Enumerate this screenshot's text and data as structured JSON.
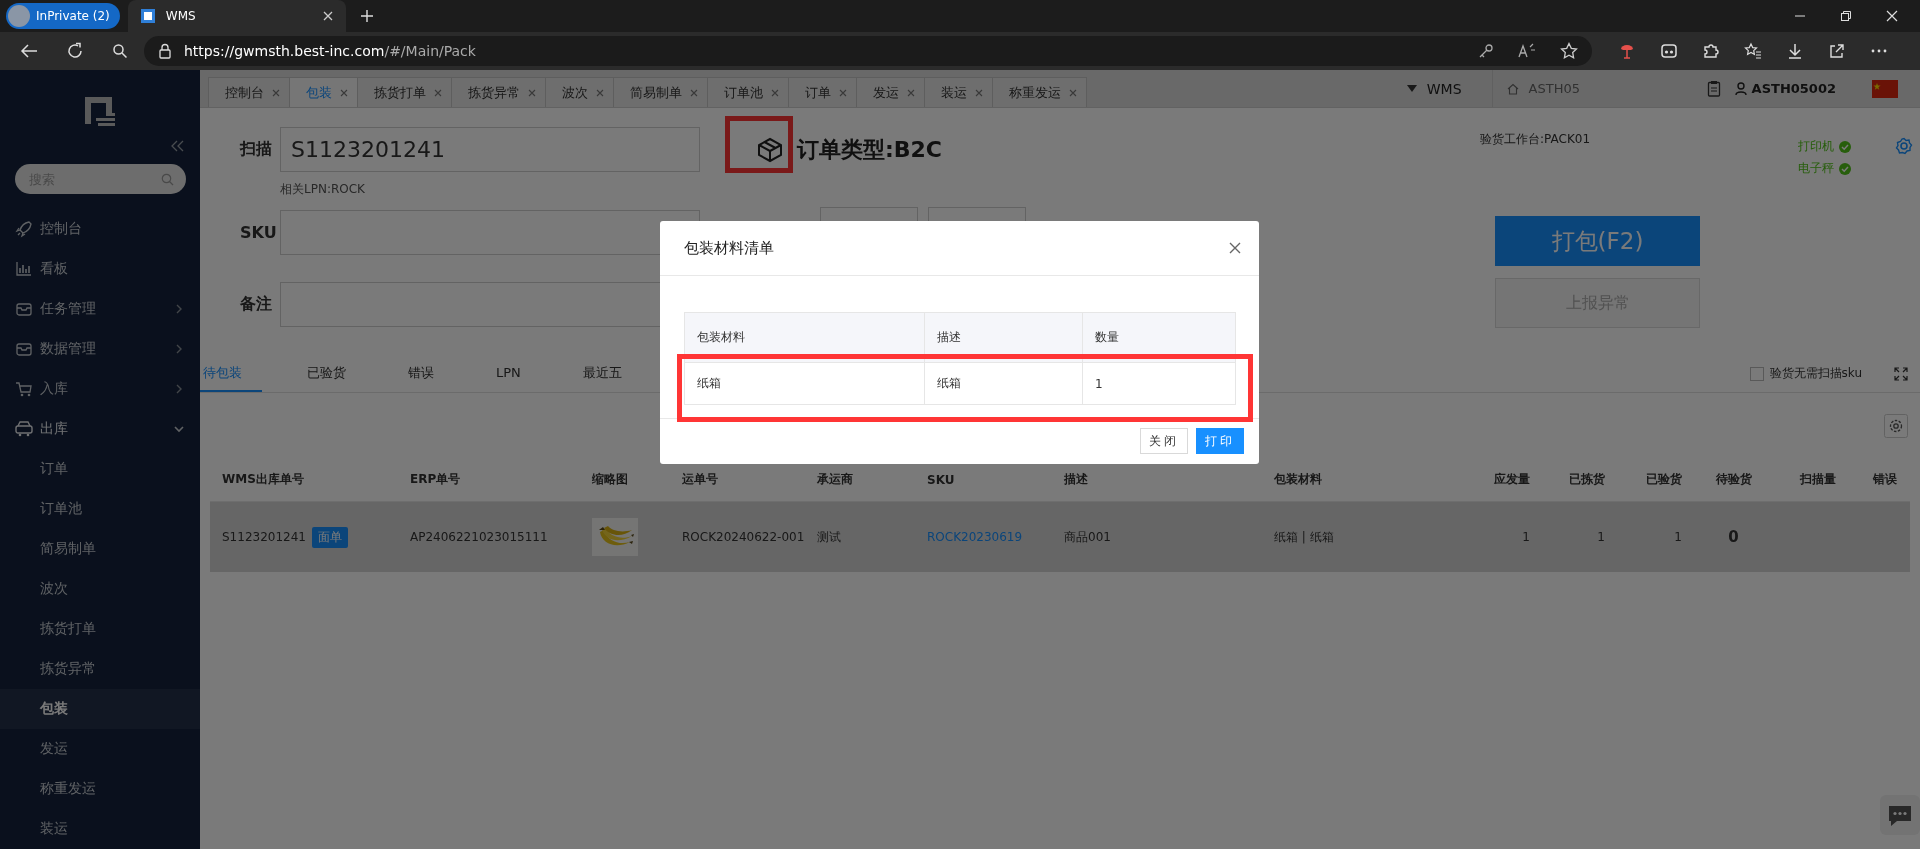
{
  "browser": {
    "profile": "InPrivate (2)",
    "tab_title": "WMS",
    "url_host": "https://gwmsth.best-inc.com",
    "url_path": "/#/Main/Pack"
  },
  "sidebar": {
    "search_placeholder": "搜索",
    "items": [
      {
        "label": "控制台",
        "selected": false
      },
      {
        "label": "看板",
        "selected": false
      },
      {
        "label": "任务管理",
        "selected": false,
        "expanded": false
      },
      {
        "label": "数据管理",
        "selected": false,
        "expanded": false
      },
      {
        "label": "入库",
        "selected": false,
        "expanded": false
      },
      {
        "label": "出库",
        "selected": false,
        "expanded": true,
        "children": [
          {
            "label": "订单",
            "selected": false
          },
          {
            "label": "订单池",
            "selected": false
          },
          {
            "label": "简易制单",
            "selected": false
          },
          {
            "label": "波次",
            "selected": false
          },
          {
            "label": "拣货打单",
            "selected": false
          },
          {
            "label": "拣货异常",
            "selected": false
          },
          {
            "label": "包装",
            "selected": true
          },
          {
            "label": "发运",
            "selected": false
          },
          {
            "label": "称重发运",
            "selected": false
          },
          {
            "label": "装运",
            "selected": false
          }
        ]
      }
    ]
  },
  "page_tabs": [
    {
      "label": "控制台",
      "selected": false
    },
    {
      "label": "包装",
      "selected": true
    },
    {
      "label": "拣货打单",
      "selected": false
    },
    {
      "label": "拣货异常",
      "selected": false
    },
    {
      "label": "波次",
      "selected": false
    },
    {
      "label": "简易制单",
      "selected": false
    },
    {
      "label": "订单池",
      "selected": false
    },
    {
      "label": "订单",
      "selected": false
    },
    {
      "label": "发运",
      "selected": false
    },
    {
      "label": "装运",
      "selected": false
    },
    {
      "label": "称重发运",
      "selected": false
    }
  ],
  "header": {
    "system": "WMS",
    "warehouse": "ASTH05",
    "user": "ASTH05002"
  },
  "form": {
    "scan": {
      "label": "扫描",
      "value": "S1123201241"
    },
    "lpn": "相关LPN:ROCK",
    "order_type": {
      "text": "订单类型:B2C",
      "highlighted": true
    },
    "sku": {
      "label": "SKU"
    },
    "remark": {
      "label": "备注"
    },
    "station": "验货工作台:PACK01",
    "devices": [
      {
        "label": "打印机",
        "ok": true
      },
      {
        "label": "电子秤",
        "ok": true
      }
    ],
    "pack_button": "打包(F2)",
    "report_button": {
      "label": "上报异常",
      "disabled": true
    },
    "skip_sku_check": {
      "label": "验货无需扫描sku",
      "checked": false
    }
  },
  "sub_tabs": [
    {
      "label": "待包装",
      "selected": true
    },
    {
      "label": "已验货",
      "selected": false
    },
    {
      "label": "错误",
      "selected": false
    },
    {
      "label": "LPN",
      "selected": false
    },
    {
      "label": "最近五",
      "selected": false
    }
  ],
  "table": {
    "columns": [
      "WMS出库单号",
      "ERP单号",
      "缩略图",
      "运单号",
      "承运商",
      "SKU",
      "描述",
      "包装材料",
      "应发量",
      "已拣货",
      "已验货",
      "待验货",
      "扫描量",
      "错误"
    ],
    "rows": [
      {
        "selected": true,
        "wms_no": "S1123201241",
        "tag": "面单",
        "erp_no": "AP2406221023015111",
        "waybill": "ROCK20240622-001",
        "carrier": "测试",
        "sku": "ROCK20230619",
        "description": "商品001",
        "material": "纸箱 | 纸箱",
        "shipped": "1",
        "picked": "1",
        "checked": "1",
        "pending": "0"
      }
    ]
  },
  "modal": {
    "title": "包装材料清单",
    "columns": [
      "包装材料",
      "描述",
      "数量"
    ],
    "rows": [
      {
        "cells": [
          "纸箱",
          "纸箱",
          "1"
        ],
        "highlighted": true
      }
    ],
    "close_button": "关闭",
    "print_button": "打印"
  }
}
